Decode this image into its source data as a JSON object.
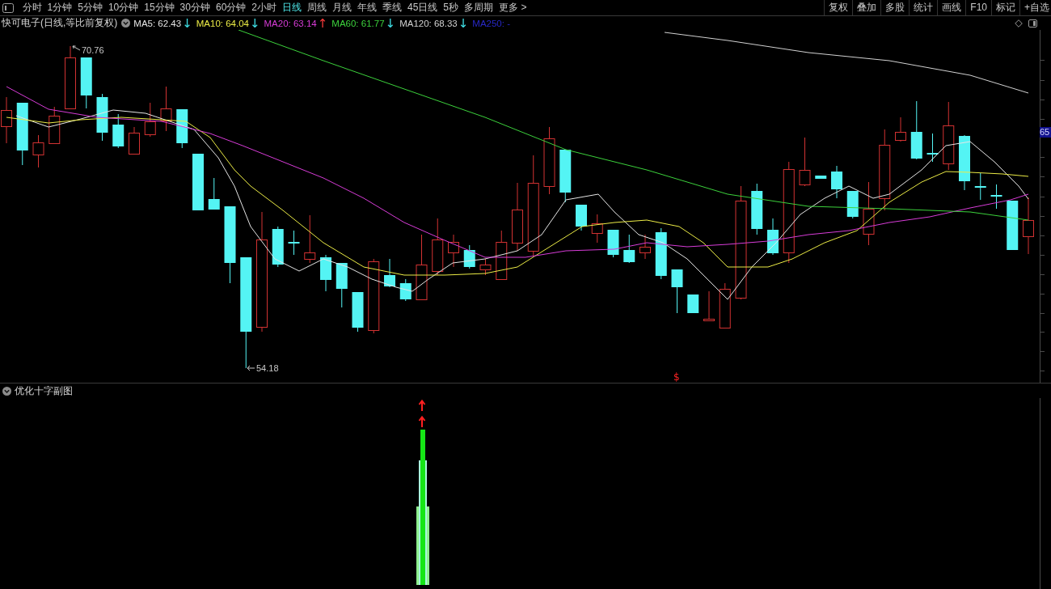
{
  "toolbar": {
    "periods": [
      {
        "label": "分时",
        "selected": false
      },
      {
        "label": "1分钟",
        "selected": false
      },
      {
        "label": "5分钟",
        "selected": false
      },
      {
        "label": "10分钟",
        "selected": false
      },
      {
        "label": "15分钟",
        "selected": false
      },
      {
        "label": "30分钟",
        "selected": false
      },
      {
        "label": "60分钟",
        "selected": false
      },
      {
        "label": "2小时",
        "selected": false
      },
      {
        "label": "日线",
        "selected": true
      },
      {
        "label": "周线",
        "selected": false
      },
      {
        "label": "月线",
        "selected": false
      },
      {
        "label": "年线",
        "selected": false
      },
      {
        "label": "季线",
        "selected": false
      },
      {
        "label": "45日线",
        "selected": false
      },
      {
        "label": "5秒",
        "selected": false
      },
      {
        "label": "多周期",
        "selected": false
      },
      {
        "label": "更多 >",
        "selected": false
      }
    ],
    "actions": [
      "复权",
      "叠加",
      "多股",
      "统计",
      "画线",
      "F10",
      "标记",
      "+自选"
    ]
  },
  "main_chart": {
    "title": "快可电子(日线,等比前复权)",
    "moving_averages": [
      {
        "label": "MA5: 62.43",
        "arrow": "↓",
        "rising": false,
        "color": "#e6e6e6"
      },
      {
        "label": "MA10: 64.04",
        "arrow": "↓",
        "rising": false,
        "color": "#ecec46"
      },
      {
        "label": "MA20: 63.14",
        "arrow": "↑",
        "rising": true,
        "color": "#d83cd8"
      },
      {
        "label": "MA60: 61.77",
        "arrow": "↓",
        "rising": false,
        "color": "#3cd23c"
      },
      {
        "label": "MA120: 68.33",
        "arrow": "↓",
        "rising": false,
        "color": "#d2d2d2"
      },
      {
        "label": "MA250: -",
        "color": "#2828c8"
      }
    ],
    "high_label": "70.76",
    "low_label": "54.18",
    "price_tag": "65",
    "signal_marker": "$"
  },
  "sub_chart": {
    "title": "优化十字副图"
  }
}
